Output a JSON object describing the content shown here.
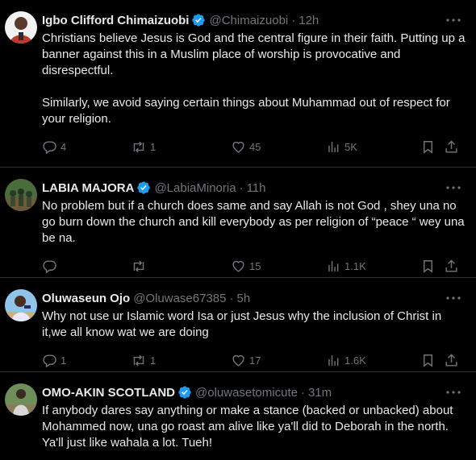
{
  "colors": {
    "background": "#000000",
    "text": "#e7e9ea",
    "muted": "#71767b",
    "divider": "#2f3336",
    "verified": "#1d9bf0"
  },
  "tweets": [
    {
      "name": "Igbo Clifford Chimaizuobi",
      "verified": true,
      "handle": "@Chimaizuobi",
      "time": "12h",
      "text": "Christians believe Jesus is God and the central figure in their faith. Putting up a banner against this in a Muslim place of worship is provocative and disrespectful.\n\nSimilarly, we avoid saying certain things about Muhammad out of respect for your religion.",
      "replies": "4",
      "retweets": "1",
      "likes": "45",
      "views": "5K",
      "avatar_icon": "avatar-portrait-red"
    },
    {
      "name": "LABIA MAJORA",
      "verified": true,
      "handle": "@LabiaMinoria",
      "time": "11h",
      "text": "No problem but if a church does same and say Allah is not God , shey una no go burn down the church and kill everybody as per religion of “peace “ wey una be na.",
      "replies": "",
      "retweets": "",
      "likes": "15",
      "views": "1.1K",
      "avatar_icon": "avatar-group-green"
    },
    {
      "name": "Oluwaseun Ojo",
      "verified": false,
      "handle": "@Oluwase67385",
      "time": "5h",
      "text": "Why not use ur Islamic word Isa or just Jesus why the inclusion of Christ in it,we all know wat we are doing",
      "replies": "1",
      "retweets": "1",
      "likes": "17",
      "views": "1.6K",
      "avatar_icon": "avatar-portrait-sky"
    },
    {
      "name": "OMO-AKIN SCOTLAND",
      "verified": true,
      "handle": "@oluwasetomicute",
      "time": "31m",
      "text": "If anybody dares say anything or make a stance (backed or unbacked) about Mohammed now, una go roast am alive like ya'll did to Deborah in the north. Ya'll just like wahala a lot. Tueh!",
      "replies": "",
      "retweets": "",
      "likes": "",
      "views": "",
      "avatar_icon": "avatar-portrait-outdoor"
    }
  ],
  "separator": "·"
}
